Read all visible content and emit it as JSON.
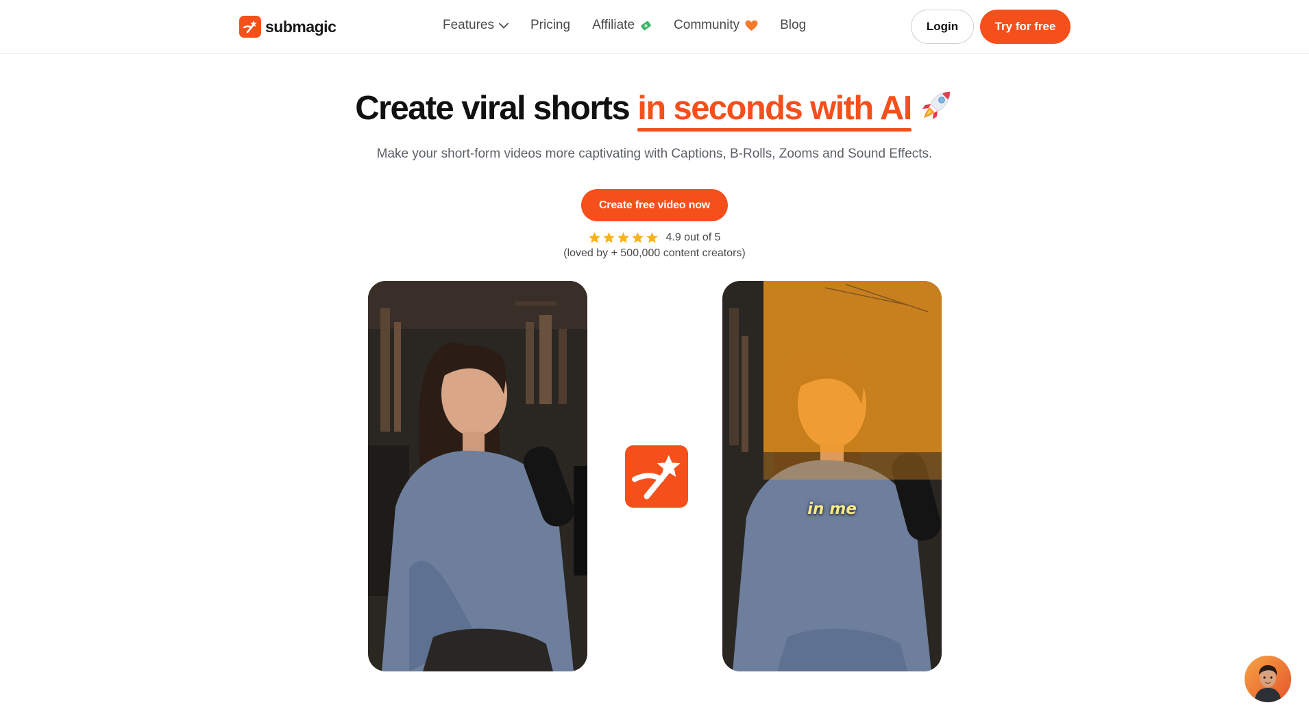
{
  "brand": {
    "name": "submagic",
    "accent_color": "#f5501b",
    "logo_icon": "magic-wand-icon"
  },
  "nav": {
    "items": [
      {
        "label": "Features",
        "icon": "chevron-down-icon"
      },
      {
        "label": "Pricing"
      },
      {
        "label": "Affiliate",
        "icon": "money-emoji-icon"
      },
      {
        "label": "Community",
        "icon": "orange-heart-icon"
      },
      {
        "label": "Blog"
      }
    ]
  },
  "header": {
    "login_label": "Login",
    "try_label": "Try for free"
  },
  "hero": {
    "title_main": "Create viral shorts ",
    "title_accent": "in seconds with AI",
    "title_icon": "rocket-icon",
    "subtitle": "Make your short-form videos more captivating with Captions, B-Rolls, Zooms and Sound Effects.",
    "cta_label": "Create free video now",
    "rating": {
      "stars": 5,
      "text": "4.9 out of 5",
      "social_proof": "(loved by + 500,000 content creators)"
    }
  },
  "demo": {
    "before_video": "original-video",
    "after_video": "edited-video",
    "caption_text": "in me"
  },
  "chat": {
    "icon": "support-avatar-icon"
  }
}
